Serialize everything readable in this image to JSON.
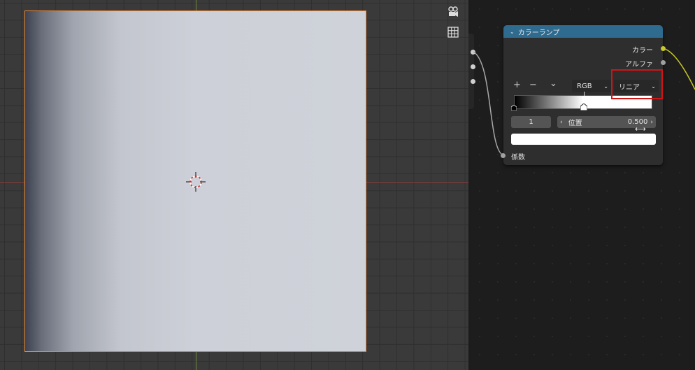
{
  "node": {
    "title": "カラーランプ",
    "outputs": {
      "color": "カラー",
      "alpha": "アルファ"
    },
    "toolbar": {
      "add": "+",
      "remove": "−",
      "menu": "⌄"
    },
    "color_mode": "RGB",
    "interpolation": "リニア",
    "stop_index": "1",
    "position_label": "位置",
    "position_value": "0.500",
    "input": {
      "factor": "係数"
    },
    "selected_stop_color": "#ffffff"
  },
  "colors": {
    "node_header": "#2e6b8f",
    "plane_outline": "#e8893a",
    "color_socket": "#c7c729",
    "highlight_box": "#d11414"
  }
}
